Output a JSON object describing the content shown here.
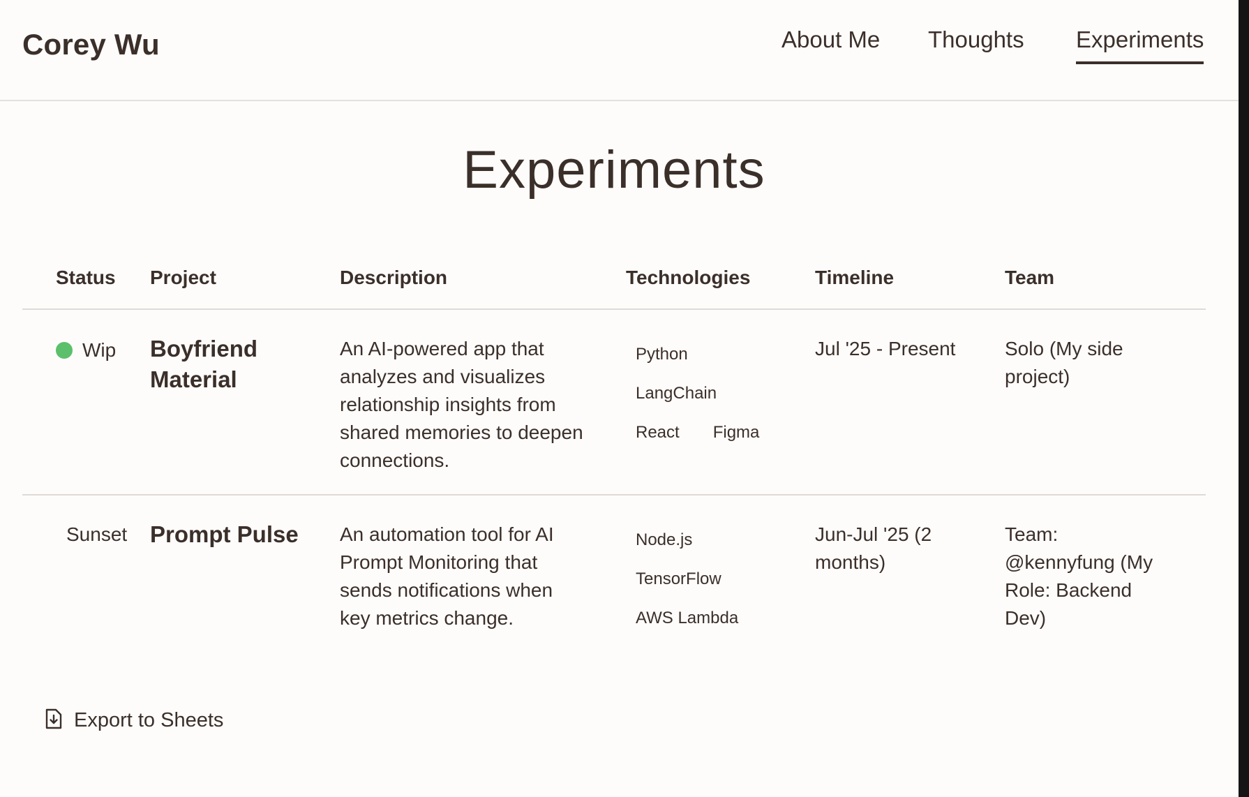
{
  "header": {
    "site_title": "Corey Wu",
    "nav": [
      {
        "label": "About Me",
        "active": false
      },
      {
        "label": "Thoughts",
        "active": false
      },
      {
        "label": "Experiments",
        "active": true
      }
    ]
  },
  "main": {
    "title": "Experiments",
    "table": {
      "columns": [
        "Status",
        "Project",
        "Description",
        "Technologies",
        "Timeline",
        "Team"
      ],
      "rows": [
        {
          "status": "Wip",
          "status_color": "#5cbf6b",
          "project_line1": "Boyfriend",
          "project_line2": "Material",
          "description_lines": [
            "An AI-powered app that",
            "analyzes and visualizes",
            "relationship insights from",
            "shared memories to deepen",
            "connections."
          ],
          "technologies": [
            "Python",
            "LangChain",
            "React",
            "Figma"
          ],
          "timeline_lines": [
            "Jul '25 - Present"
          ],
          "team_lines": [
            "Solo (My side",
            "project)"
          ]
        },
        {
          "status": "Sunset",
          "project_line1": "Prompt Pulse",
          "description_lines": [
            "An automation tool for AI",
            "Prompt Monitoring that",
            "sends notifications when",
            "key metrics change."
          ],
          "technologies": [
            "Node.js",
            "TensorFlow",
            "AWS Lambda"
          ],
          "timeline_lines": [
            "Jun-Jul '25 (2",
            "months)"
          ],
          "team_lines": [
            "Team:",
            "@kennyfung (My",
            "Role: Backend",
            "Dev)"
          ]
        }
      ]
    },
    "export_label": "Export to Sheets",
    "export_icon": "file-export-icon"
  },
  "colors": {
    "background": "#fdfcfb",
    "text": "#3b2f2a",
    "status_wip": "#5cbf6b",
    "divider": "#dedad6"
  }
}
